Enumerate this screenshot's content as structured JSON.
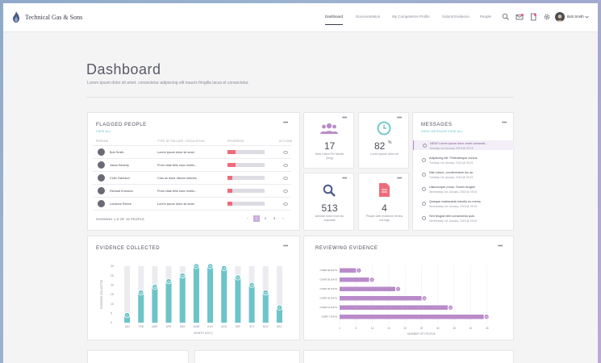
{
  "header": {
    "brand": "Technical Gas & Sons",
    "nav": [
      "Dashboard",
      "Documentation",
      "My Competence Profile",
      "Submit Evidence",
      "People"
    ],
    "user_name": "Bob Smith"
  },
  "page": {
    "title": "Dashboard",
    "subtitle": "Lorem ipsum dolor sit amet, consectetur adipiscing elit mauris fringilla lacus et consectetur."
  },
  "flagged": {
    "title": "FLAGGED PEOPLE",
    "view_all": "VIEW ALL",
    "more": "•••",
    "columns": [
      "PERSON",
      "TYPE OF FAILURE / ESCALATION",
      "PROGRESS",
      "ACTIONS"
    ],
    "rows": [
      {
        "name": "Bob Smith",
        "failure": "Lorem ipsum dolor sit amet",
        "progress": 0.22
      },
      {
        "name": "Jason Beverly",
        "failure": "Proin vitae felis nunc mollis...",
        "progress": 0.22
      },
      {
        "name": "Colin Clarkson",
        "failure": "Cras ac dolor dictum ultricies",
        "progress": 0.12
      },
      {
        "name": "Richard Ericsson",
        "failure": "Proin vitae felis nunc mollis...",
        "progress": 0.12
      },
      {
        "name": "Lorianne Reese",
        "failure": "Lorem ipsum dolor sit amet",
        "progress": 0.12
      }
    ],
    "footer": "SHOWING 1-5 OF 15 PEOPLE",
    "pages": [
      "‹",
      "1",
      "2",
      "3",
      "›"
    ]
  },
  "stats": [
    {
      "value": "17",
      "label": "New Users Per Month [Avg]"
    },
    {
      "value": "82",
      "unit": "%",
      "label": "Lorem ipsum dolor sit"
    },
    {
      "value": "513",
      "label": "Aenean tortor erat nec vulputate"
    },
    {
      "value": "4",
      "label": "People with evidence review not logs"
    }
  ],
  "messages": {
    "title": "MESSAGES",
    "send": "SEND MESSAGE",
    "view_all": "VIEW ALL",
    "more": "•••",
    "items": [
      {
        "title": "NEW! Lorem ipsum dolor amet consecte...",
        "date": "Monday 1st January, 2018 @ 09:15",
        "unread": true
      },
      {
        "title": "Adipiscing elit. Pellentesque cursus",
        "date": "Tuesday 1st January, 2018 @ 09:15",
        "unread": false
      },
      {
        "title": "Nisi rutrum, condimentum leo ac",
        "date": "Tuesday 1st January, 2018 @ 09:15",
        "unread": false
      },
      {
        "title": "Ullamcorper purus. Donec feugiat",
        "date": "Wednesday 1st January, 2018 @ 09:15",
        "unread": false
      },
      {
        "title": "Quisque malesuada lobortis eu metus",
        "date": "Wednesday 1st January, 2018 @ 09:15",
        "unread": false
      },
      {
        "title": "Sed feugiat nibh consectetur quis",
        "date": "Wednesday 1st January, 2018 @ 09:15",
        "unread": false
      }
    ]
  },
  "evidence": {
    "title": "EVIDENCE COLLECTED",
    "more": "•••"
  },
  "reviewing": {
    "title": "REVIEWING EVIDENCE",
    "more": "•••"
  },
  "chart_data": [
    {
      "type": "bar",
      "title": "EVIDENCE COLLECTED",
      "categories": [
        "JAN",
        "FEB",
        "MAR",
        "APR",
        "MAY",
        "JUNE",
        "JULY",
        "AUG",
        "SEP",
        "OCT",
        "NOV",
        "DEC"
      ],
      "values": [
        4,
        16,
        19,
        22,
        25,
        30,
        30,
        29,
        24,
        20,
        16,
        8
      ],
      "xlabel": "MONTH (2017)",
      "ylabel": "EVIDENCE COLLECTED",
      "ylim": [
        0,
        30
      ],
      "yticks": [
        0,
        5,
        10,
        15,
        20,
        25,
        30
      ],
      "color": "#6cc4c9"
    },
    {
      "type": "bar",
      "orientation": "horizontal",
      "title": "REVIEWING EVIDENCE",
      "categories": [
        "OVER 60 DAYS",
        "OVER 50 DAYS",
        "OVER 40 DAYS",
        "OVER 30 DAYS",
        "OVER 14 DAYS",
        "OVER 7 DAYS"
      ],
      "values": [
        5,
        9,
        17,
        25,
        33,
        44
      ],
      "xlabel": "NUMBER OF PEOPLE",
      "xlim": [
        0,
        50
      ],
      "xticks": [
        0,
        5,
        10,
        15,
        20,
        25,
        30,
        35,
        40,
        45
      ],
      "color": "#b98bc9"
    }
  ]
}
